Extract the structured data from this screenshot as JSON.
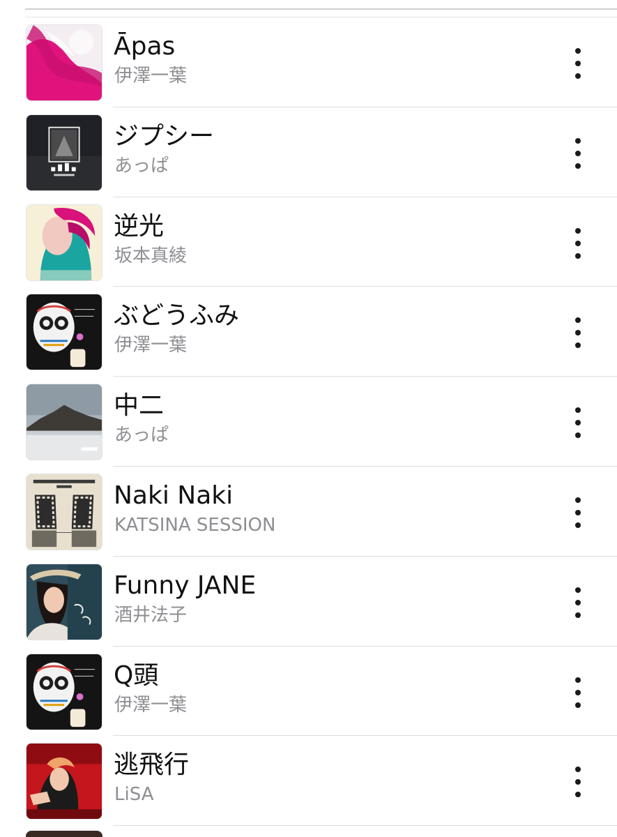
{
  "songs": [
    {
      "title": "Āpas",
      "artist": "伊澤一葉",
      "art": "pink-splash"
    },
    {
      "title": "ジプシー",
      "artist": "あっぱ",
      "art": "appa-dark"
    },
    {
      "title": "逆光",
      "artist": "坂本真綾",
      "art": "portrait-pink"
    },
    {
      "title": "ぶどうふみ",
      "artist": "伊澤一葉",
      "art": "skull"
    },
    {
      "title": "中二",
      "artist": "あっぱ",
      "art": "mountain"
    },
    {
      "title": "Naki Naki",
      "artist": "KATSINA SESSION",
      "art": "katsina"
    },
    {
      "title": "Funny JANE",
      "artist": "酒井法子",
      "art": "noriko"
    },
    {
      "title": "Q頭",
      "artist": "伊澤一葉",
      "art": "skull"
    },
    {
      "title": "逃飛行",
      "artist": "LiSA",
      "art": "lisa"
    }
  ],
  "colors": {
    "title": "#111111",
    "artist": "#8e8e93",
    "separator": "#dedede"
  }
}
